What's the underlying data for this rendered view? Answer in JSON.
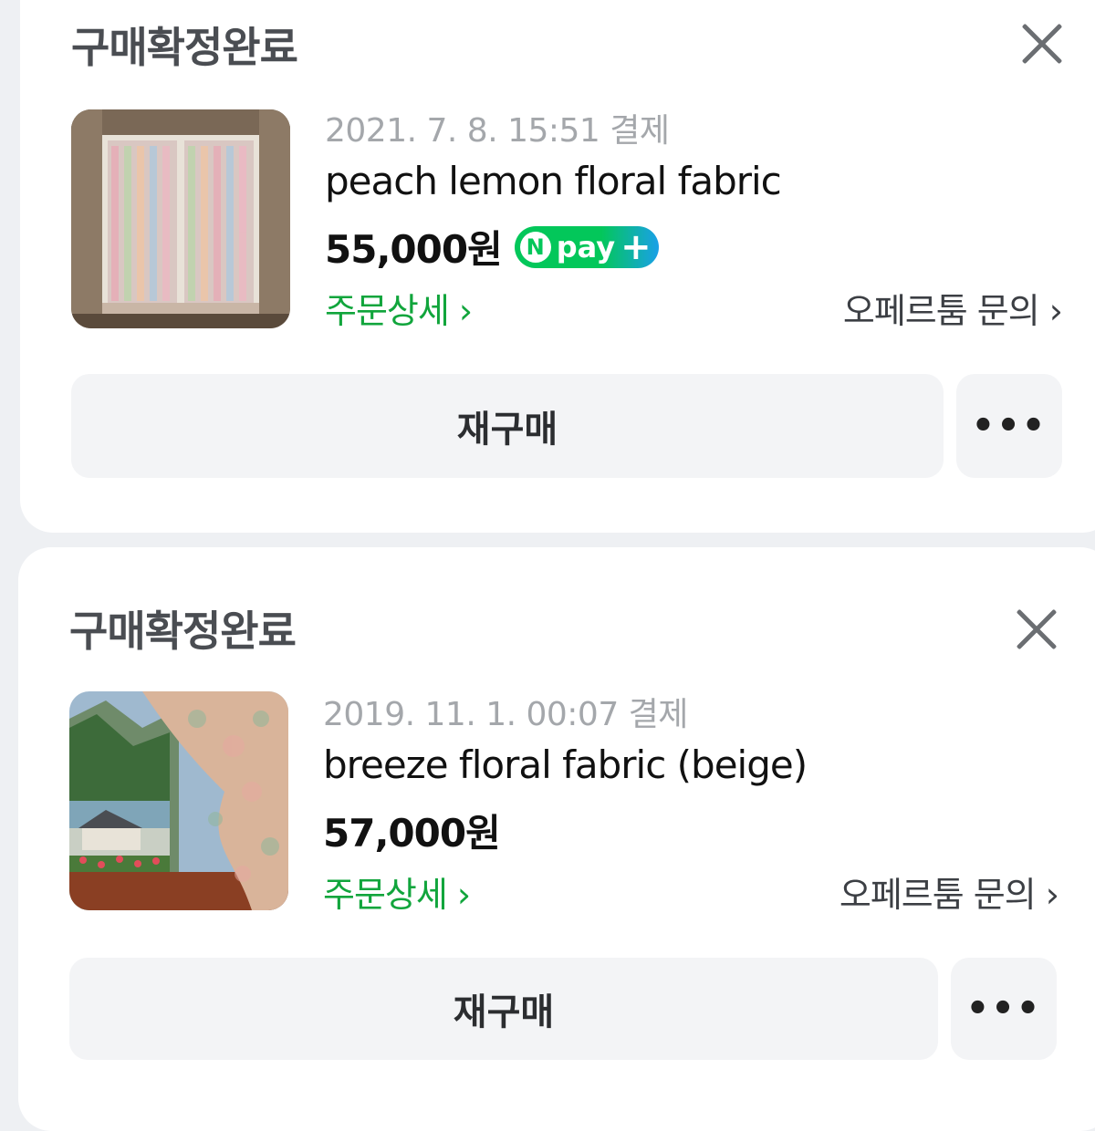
{
  "orders": [
    {
      "status": "구매확정완료",
      "date": "2021. 7. 8. 15:51 결제",
      "title": "peach lemon floral fabric",
      "price": "55,000원",
      "npay_badge": {
        "n": "N",
        "text": "pay",
        "plus": "+"
      },
      "order_detail_label": "주문상세 ›",
      "inquiry_label": "오페르툼 문의 ›",
      "rebuy_label": "재구매",
      "more_label": "•••"
    },
    {
      "status": "구매확정완료",
      "date": "2019. 11. 1. 00:07 결제",
      "title": "breeze floral fabric (beige)",
      "price": "57,000원",
      "order_detail_label": "주문상세 ›",
      "inquiry_label": "오페르툼 문의 ›",
      "rebuy_label": "재구매",
      "more_label": "•••"
    }
  ],
  "colors": {
    "accent_green": "#11a53c",
    "npay_green": "#03c75a",
    "npay_blue": "#1aa0e8",
    "background": "#eef0f3"
  }
}
